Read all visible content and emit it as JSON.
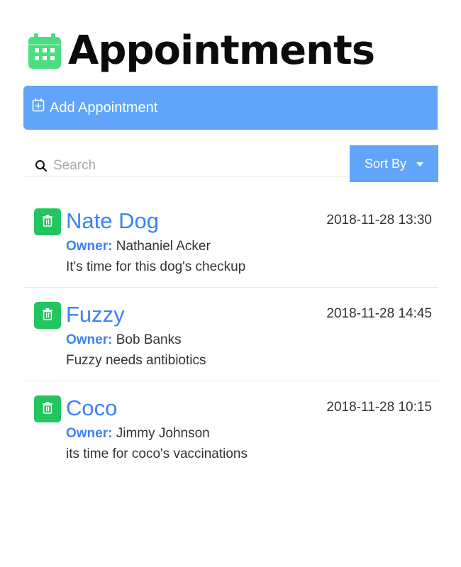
{
  "header": {
    "title": "Appointments",
    "icon": "calendar-icon",
    "icon_color": "#4ade80"
  },
  "add_bar": {
    "label": "Add Appointment",
    "icon": "plus-square-icon",
    "color": "#60a5fa"
  },
  "search": {
    "placeholder": "Search",
    "value": ""
  },
  "sort": {
    "label": "Sort By"
  },
  "owner_label": "Owner:",
  "appointments": [
    {
      "pet_name": "Nate Dog",
      "date": "2018-11-28 13:30",
      "owner": "Nathaniel Acker",
      "notes": "It's time for this dog's checkup"
    },
    {
      "pet_name": "Fuzzy",
      "date": "2018-11-28 14:45",
      "owner": "Bob Banks",
      "notes": "Fuzzy needs antibiotics"
    },
    {
      "pet_name": "Coco",
      "date": "2018-11-28 10:15",
      "owner": "Jimmy Johnson",
      "notes": "its time for coco's vaccinations"
    }
  ],
  "colors": {
    "accent": "#3b82f6",
    "button_blue": "#60a5fa",
    "delete_green": "#22c55e"
  }
}
